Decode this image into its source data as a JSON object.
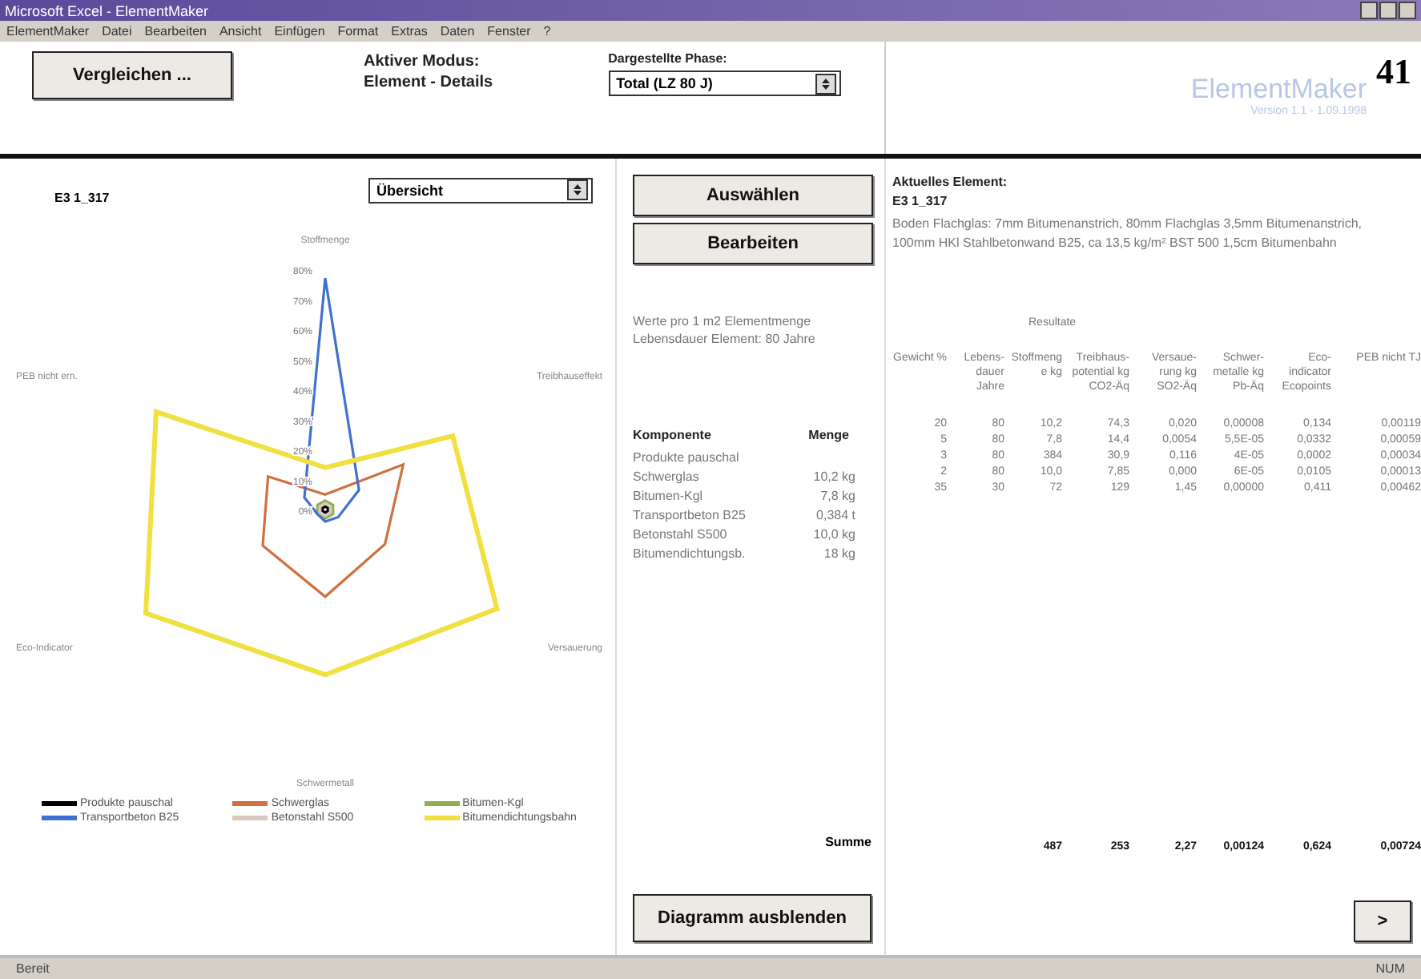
{
  "window": {
    "title": "Microsoft Excel - ElementMaker"
  },
  "menu": [
    "ElementMaker",
    "Datei",
    "Bearbeiten",
    "Ansicht",
    "Einfügen",
    "Format",
    "Extras",
    "Daten",
    "Fenster",
    "?"
  ],
  "header": {
    "compare_button": "Vergleichen ...",
    "mode_label": "Aktiver Modus:",
    "mode_value": "Element - Details",
    "phase_label": "Dargestellte Phase:",
    "phase_value": "Total (LZ 80 J)",
    "logo": "ElementMaker",
    "version": "Version 1.1 - 1.09.1998",
    "page_number": "41"
  },
  "chart_panel": {
    "element": "E3 1_317",
    "view_select": "Übersicht",
    "axis_labels": [
      "Stoffmenge",
      "Treibhauseffekt",
      "Versauerung",
      "Schwermetall",
      "Eco-Indicator",
      "PEB nicht ern."
    ],
    "tick_labels": [
      "80%",
      "70%",
      "60%",
      "50%",
      "40%",
      "30%",
      "20%",
      "10%",
      "0%"
    ],
    "legend": [
      {
        "name": "Produkte pauschal",
        "color": "#000000"
      },
      {
        "name": "Schwerglas",
        "color": "#d07040"
      },
      {
        "name": "Bitumen-Kgl",
        "color": "#90b050"
      },
      {
        "name": "Transportbeton B25",
        "color": "#4070d0"
      },
      {
        "name": "Betonstahl S500",
        "color": "#d8c8c0"
      },
      {
        "name": "Bitumendichtungsbahn",
        "color": "#f0e040"
      }
    ]
  },
  "middle": {
    "select_button": "Auswählen",
    "edit_button": "Bearbeiten",
    "notes": [
      "Werte pro 1 m2 Elementmenge",
      "Lebensdauer Element: 80 Jahre"
    ],
    "columns": [
      "Komponente",
      "Menge"
    ],
    "components": [
      {
        "name": "Produkte pauschal"
      },
      {
        "name": "Schwerglas",
        "amount": "10,2 kg"
      },
      {
        "name": "Bitumen-Kgl",
        "amount": "7,8 kg"
      },
      {
        "name": "Transportbeton B25",
        "amount": "0,384 t"
      },
      {
        "name": "Betonstahl S500",
        "amount": "10,0 kg"
      },
      {
        "name": "Bitumendichtungsb.",
        "amount": "18 kg"
      }
    ],
    "sum_label": "Summe",
    "hide_chart_button": "Diagramm ausblenden"
  },
  "details": {
    "label": "Aktuelles Element:",
    "element": "E3 1_317",
    "description": "Boden Flachglas: 7mm Bitumenanstrich, 80mm Flachglas 3,5mm Bitumenanstrich, 100mm HKl Stahlbetonwand B25, ca 13,5 kg/m² BST 500 1,5cm Bitumenbahn",
    "results_title": "Resultate",
    "columns": [
      "Gewicht %",
      "Lebens-dauer Jahre",
      "Stoffmenge kg",
      "Treibhaus-potential kg CO2-Äq",
      "Versaue-rung kg SO2-Äq",
      "Schwer-metalle kg Pb-Äq",
      "Eco-indicator Ecopoints",
      "PEB nicht TJ"
    ],
    "rows": [
      [
        "20",
        "80",
        "10,2",
        "74,3",
        "0,020",
        "0,00008",
        "0,134",
        "0,00119"
      ],
      [
        "5",
        "80",
        "7,8",
        "14,4",
        "0,0054",
        "5,5E-05",
        "0,0332",
        "0,00059"
      ],
      [
        "3",
        "80",
        "384",
        "30,9",
        "0,116",
        "4E-05",
        "0,0002",
        "0,00034"
      ],
      [
        "2",
        "80",
        "10,0",
        "7,85",
        "0,000",
        "6E-05",
        "0,0105",
        "0,00013"
      ],
      [
        "35",
        "30",
        "72",
        "129",
        "1,45",
        "0,00000",
        "0,411",
        "0,00462"
      ]
    ],
    "sum": [
      "487",
      "253",
      "2,27",
      "0,00124",
      "0,624",
      "0,00724"
    ],
    "next_button": ">"
  },
  "status_bar": {
    "left": "Bereit",
    "right": "NUM"
  }
}
